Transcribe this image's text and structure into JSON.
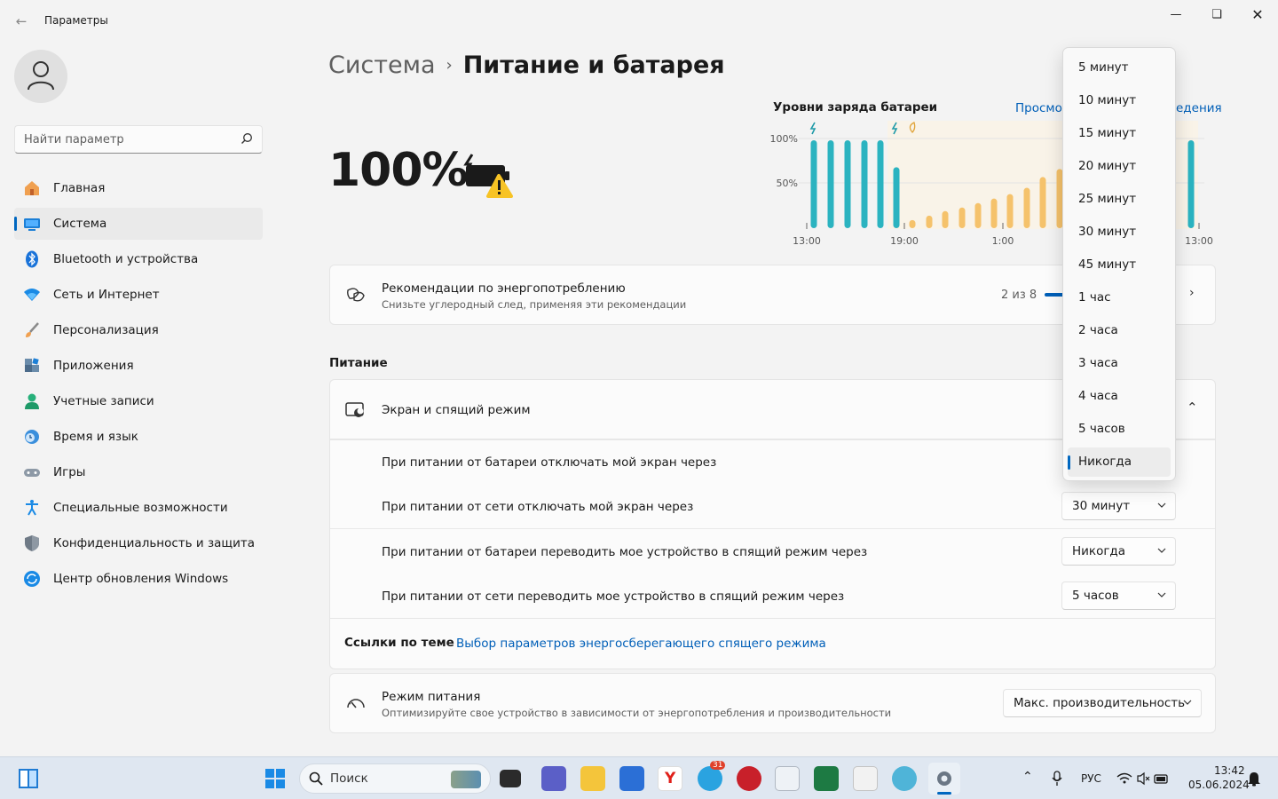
{
  "window": {
    "title": "Параметры"
  },
  "sidebar": {
    "search_placeholder": "Найти параметр",
    "items": [
      {
        "label": "Главная",
        "icon": "home-icon"
      },
      {
        "label": "Система",
        "icon": "system-icon",
        "active": true
      },
      {
        "label": "Bluetooth и устройства",
        "icon": "bluetooth-icon"
      },
      {
        "label": "Сеть и Интернет",
        "icon": "wifi-icon"
      },
      {
        "label": "Персонализация",
        "icon": "brush-icon"
      },
      {
        "label": "Приложения",
        "icon": "apps-icon"
      },
      {
        "label": "Учетные записи",
        "icon": "account-icon"
      },
      {
        "label": "Время и язык",
        "icon": "clock-globe-icon"
      },
      {
        "label": "Игры",
        "icon": "gamepad-icon"
      },
      {
        "label": "Специальные возможности",
        "icon": "accessibility-icon"
      },
      {
        "label": "Конфиденциальность и защита",
        "icon": "shield-icon"
      },
      {
        "label": "Центр обновления Windows",
        "icon": "update-icon"
      }
    ]
  },
  "header": {
    "parent": "Система",
    "separator": "›",
    "current": "Питание и батарея"
  },
  "battery": {
    "percent": "100%",
    "status_icon": "battery-warning-icon"
  },
  "chart": {
    "title": "Уровни заряда батареи",
    "link_left": "Просмот",
    "link_right": "едения"
  },
  "chart_data": {
    "type": "bar",
    "title": "Уровни заряда батареи",
    "y_ticks": [
      "100%",
      "50%"
    ],
    "x_ticks": [
      "13:00",
      "19:00",
      "1:00",
      "13:00"
    ],
    "ylim": [
      0,
      100
    ],
    "series": [
      {
        "values": [
          98,
          98,
          98,
          98,
          98
        ],
        "color": "#2bb3c0",
        "status": "charging"
      },
      {
        "values": [
          68
        ],
        "color": "#2bb3c0",
        "status": "charging"
      },
      {
        "values": [
          9,
          14,
          19,
          23,
          28,
          33,
          38,
          45,
          57,
          66
        ],
        "color": "#f5c26b",
        "status": "discharging"
      },
      {
        "values": [
          98
        ],
        "color": "#2bb3c0",
        "status": "charging"
      }
    ],
    "icons": [
      "lightning-icon",
      "lightning-icon",
      "leaf-icon"
    ]
  },
  "recommendations": {
    "title": "Рекомендации по энергопотреблению",
    "subtitle": "Снизьте углеродный след, применяя эти рекомендации",
    "progress_text": "2 из 8",
    "progress": 0.25
  },
  "power_section": {
    "label": "Питание",
    "screen_sleep": {
      "title": "Экран и спящий режим",
      "rows": [
        {
          "label": "При питании от батареи отключать мой экран через",
          "value": "Никогда"
        },
        {
          "label": "При питании от сети отключать мой экран через",
          "value": "30 минут"
        },
        {
          "label": "При питании от батареи переводить мое устройство в спящий режим через",
          "value": "Никогда"
        },
        {
          "label": "При питании от сети переводить мое устройство в спящий режим через",
          "value": "5 часов"
        }
      ]
    },
    "related": {
      "label": "Ссылки по теме",
      "link": "Выбор параметров энергосберегающего спящего режима"
    },
    "power_mode": {
      "title": "Режим питания",
      "subtitle": "Оптимизируйте свое устройство в зависимости от энергопотребления и производительности",
      "value": "Макс. производительность"
    }
  },
  "dropdown": {
    "options": [
      "5 минут",
      "10 минут",
      "15 минут",
      "20 минут",
      "25 минут",
      "30 минут",
      "45 минут",
      "1 час",
      "2 часа",
      "3 часа",
      "4 часа",
      "5 часов",
      "Никогда"
    ],
    "selected": "Никогда"
  },
  "taskbar": {
    "search_placeholder": "Поиск",
    "lang": "РУС",
    "time": "13:42",
    "date": "05.06.2024",
    "badge": "31"
  }
}
